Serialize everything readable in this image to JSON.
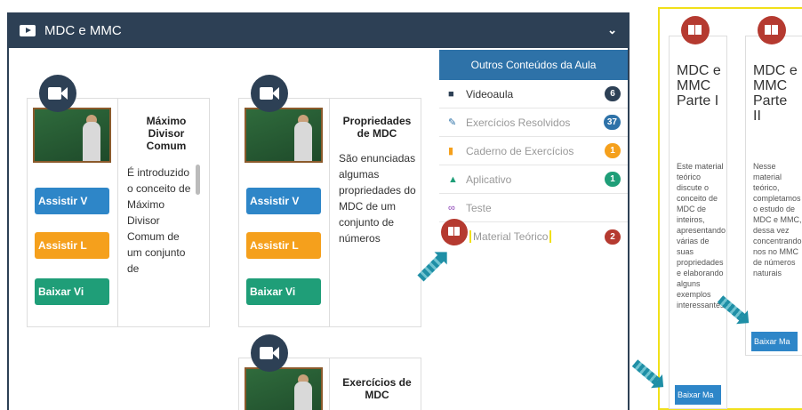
{
  "window": {
    "title": "MDC e MMC"
  },
  "cards": [
    {
      "title": "Máximo Divisor Comum",
      "desc": "É introduzido o conceito de Máximo Divisor Comum de um conjunto de",
      "btn_watch": "Assistir V",
      "btn_listen": "Assistir L",
      "btn_download": "Baixar Vi"
    },
    {
      "title": "Propriedades de MDC",
      "desc": "São enunciadas algumas propriedades do MDC de um conjunto de números",
      "btn_watch": "Assistir V",
      "btn_listen": "Assistir L",
      "btn_download": "Baixar Vi"
    },
    {
      "title": "Exercícios de MDC"
    }
  ],
  "side": {
    "header": "Outros Conteúdos da Aula",
    "items": [
      {
        "label": "Videoaula",
        "count": "6",
        "color": "#2d4055"
      },
      {
        "label": "Exercícios Resolvidos",
        "count": "37",
        "color": "#2e72a8"
      },
      {
        "label": "Caderno de Exercícios",
        "count": "1",
        "color": "#f5a01c"
      },
      {
        "label": "Aplicativo",
        "count": "1",
        "color": "#1f9e78"
      },
      {
        "label": "Teste",
        "count": "",
        "color": ""
      },
      {
        "label": "Material Teórico",
        "count": "2",
        "color": "#b53a30"
      }
    ]
  },
  "zoom": {
    "cards": [
      {
        "title": "MDC e MMC Parte I",
        "desc": "Este material teórico discute o conceito de MDC de inteiros, apresentando várias de suas propriedades e elaborando alguns exemplos interessantes",
        "btn": "Baixar Ma"
      },
      {
        "title": "MDC e MMC Parte II",
        "desc": "Nesse material teórico, completamos o estudo de MDC e MMC, dessa vez concentrando nos no MMC de números naturais",
        "btn": "Baixar Ma"
      }
    ]
  }
}
